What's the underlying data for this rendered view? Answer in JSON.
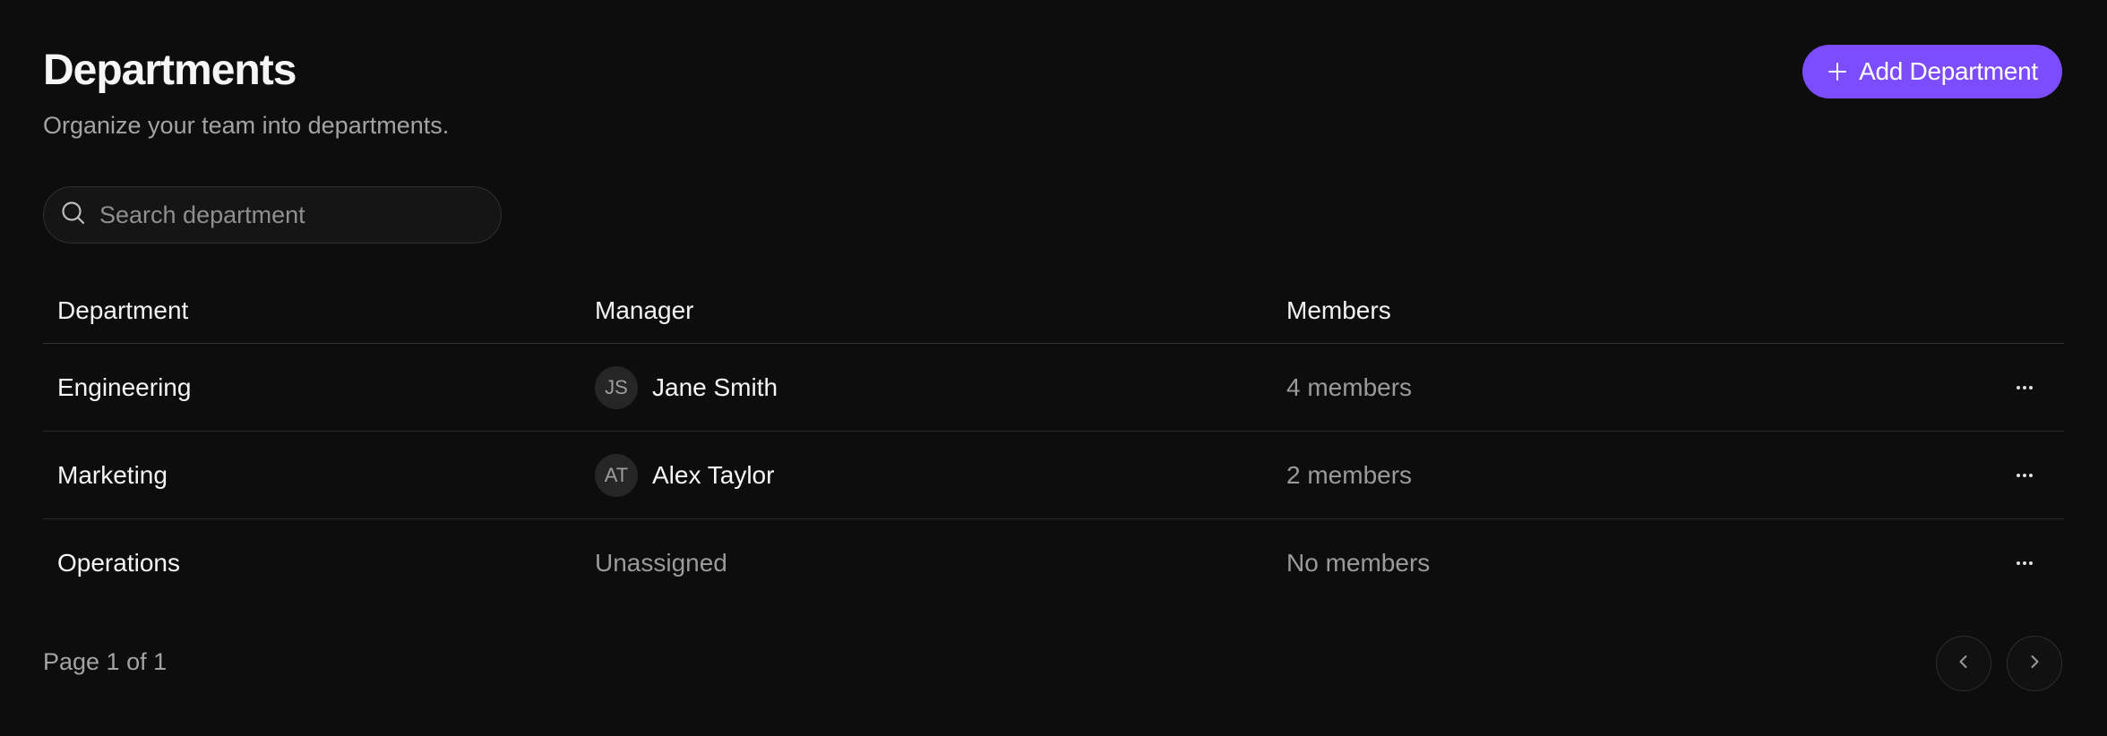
{
  "header": {
    "title": "Departments",
    "subtitle": "Organize your team into departments.",
    "add_button_label": "Add Department"
  },
  "search": {
    "placeholder": "Search department",
    "value": ""
  },
  "table": {
    "columns": [
      "Department",
      "Manager",
      "Members"
    ],
    "rows": [
      {
        "department": "Engineering",
        "manager_initials": "JS",
        "manager": "Jane Smith",
        "members": "4 members"
      },
      {
        "department": "Marketing",
        "manager_initials": "AT",
        "manager": "Alex Taylor",
        "members": "2 members"
      },
      {
        "department": "Operations",
        "manager_initials": "",
        "manager": "Unassigned",
        "members": "No members"
      }
    ]
  },
  "footer": {
    "page_text": "Page 1 of 1"
  },
  "icons": {
    "add": "plus-icon",
    "search": "search-icon",
    "row_action": "more-horizontal-icon",
    "prev": "chevron-left-icon",
    "next": "chevron-right-icon"
  },
  "colors": {
    "background": "#0d0d0d",
    "accent": "#7c4dff",
    "muted_text": "#9a9a9a",
    "divider": "#2a2a2a"
  }
}
